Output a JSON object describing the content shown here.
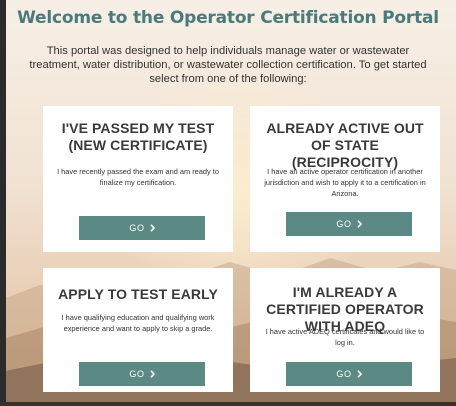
{
  "page": {
    "title": "Welcome to the Operator Certification Portal",
    "intro": "This portal was designed to help individuals manage water or wastewater treatment, water distribution, or wastewater collection certification. To get started select from one of the following:"
  },
  "cards": [
    {
      "title": "I'VE PASSED MY TEST (NEW CERTIFICATE)",
      "description": "I have recently passed the exam and am ready to finalize my certification.",
      "button": "GO"
    },
    {
      "title": "ALREADY ACTIVE OUT OF STATE (RECIPROCITY)",
      "description": "I have an active operator certification in another jurisdiction and wish to apply it to a certification in Arizona.",
      "button": "GO"
    },
    {
      "title": "APPLY TO TEST EARLY",
      "description": "I have qualifying education and qualifying work experience and want to apply to skip a grade.",
      "button": "GO"
    },
    {
      "title": "I'M ALREADY A CERTIFIED OPERATOR WITH ADEQ",
      "description": "I have active ADEQ certificates and would like to log in.",
      "button": "GO"
    }
  ],
  "icons": {
    "button_icon": "chevron-right-icon"
  },
  "colors": {
    "title": "#4a7b7a",
    "button": "#5b8a84",
    "card": "#ffffff"
  }
}
